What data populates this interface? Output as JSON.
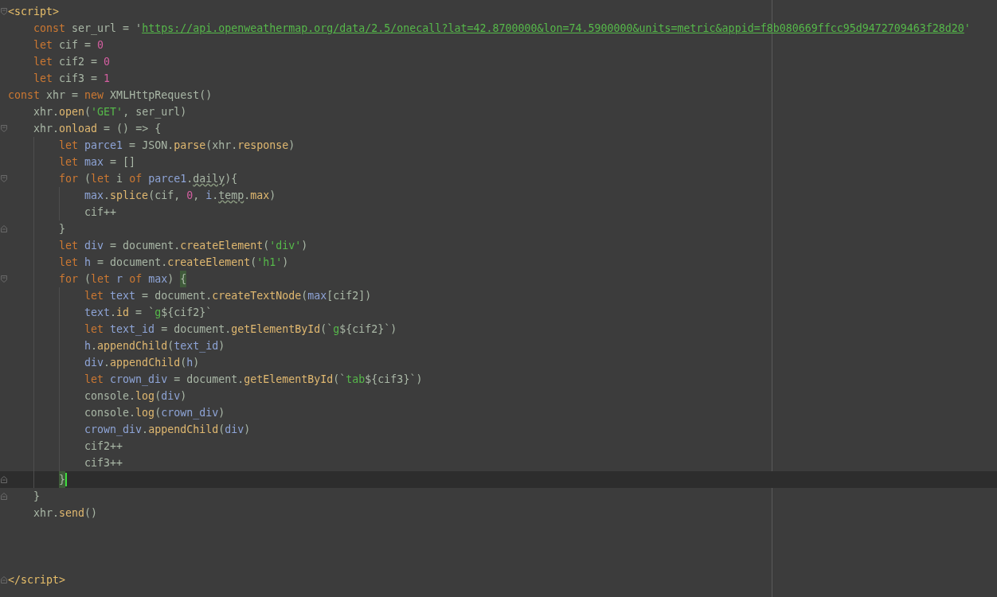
{
  "editor": {
    "lines": [
      {
        "current": false,
        "gutter": {
          "kind": "fold_open"
        },
        "tokens": [
          {
            "text": "<script>",
            "kind": "tag"
          }
        ]
      },
      {
        "current": false,
        "tokens": [
          {
            "text": "    const",
            "kind": "kw"
          },
          {
            "text": " ser_url = '",
            "kind": "plain"
          },
          {
            "text": "https://api.openweathermap.org/data/2.5/onecall?lat=42.8700000&lon=74.5900000&units=metric&appid=f8b080669ffcc95d9472709463f28d20",
            "kind": "link"
          },
          {
            "text": "'",
            "kind": "str"
          }
        ]
      },
      {
        "current": false,
        "tokens": [
          {
            "text": "    let",
            "kind": "kw"
          },
          {
            "text": " cif = ",
            "kind": "plain"
          },
          {
            "text": "0",
            "kind": "num"
          }
        ]
      },
      {
        "current": false,
        "tokens": [
          {
            "text": "    let",
            "kind": "kw"
          },
          {
            "text": " cif2 = ",
            "kind": "plain"
          },
          {
            "text": "0",
            "kind": "num"
          }
        ]
      },
      {
        "current": false,
        "tokens": [
          {
            "text": "    let",
            "kind": "kw"
          },
          {
            "text": " cif3 = ",
            "kind": "plain"
          },
          {
            "text": "1",
            "kind": "num"
          }
        ]
      },
      {
        "current": false,
        "tokens": [
          {
            "text": "const",
            "kind": "kw"
          },
          {
            "text": " xhr = ",
            "kind": "plain"
          },
          {
            "text": "new",
            "kind": "kw"
          },
          {
            "text": " XMLHttpRequest()",
            "kind": "plain"
          }
        ]
      },
      {
        "current": false,
        "tokens": [
          {
            "text": "    xhr.",
            "kind": "plain"
          },
          {
            "text": "open",
            "kind": "fn"
          },
          {
            "text": "(",
            "kind": "plain"
          },
          {
            "text": "'GET'",
            "kind": "str"
          },
          {
            "text": ", ser_url)",
            "kind": "plain"
          }
        ]
      },
      {
        "current": false,
        "gutter": {
          "kind": "fold_open"
        },
        "tokens": [
          {
            "text": "    xhr.",
            "kind": "plain"
          },
          {
            "text": "onload",
            "kind": "fn"
          },
          {
            "text": " = () => {",
            "kind": "plain"
          }
        ]
      },
      {
        "current": false,
        "tokens": [
          {
            "text": "        let",
            "kind": "kw"
          },
          {
            "text": " parce1",
            "kind": "var"
          },
          {
            "text": " = JSON.",
            "kind": "plain"
          },
          {
            "text": "parse",
            "kind": "fn"
          },
          {
            "text": "(xhr.",
            "kind": "plain"
          },
          {
            "text": "response",
            "kind": "fn"
          },
          {
            "text": ")",
            "kind": "plain"
          }
        ]
      },
      {
        "current": false,
        "tokens": [
          {
            "text": "        let",
            "kind": "kw"
          },
          {
            "text": " max",
            "kind": "var"
          },
          {
            "text": " = []",
            "kind": "plain"
          }
        ]
      },
      {
        "current": false,
        "gutter": {
          "kind": "fold_open"
        },
        "tokens": [
          {
            "text": "        for",
            "kind": "kw"
          },
          {
            "text": " (",
            "kind": "plain"
          },
          {
            "text": "let",
            "kind": "kw"
          },
          {
            "text": " i ",
            "kind": "plain"
          },
          {
            "text": "of",
            "kind": "kw"
          },
          {
            "text": " parce1",
            "kind": "var"
          },
          {
            "text": ".",
            "kind": "plain"
          },
          {
            "text": "daily",
            "kind": "warn"
          },
          {
            "text": "){",
            "kind": "plain"
          }
        ]
      },
      {
        "current": false,
        "tokens": [
          {
            "text": "            max",
            "kind": "var"
          },
          {
            "text": ".",
            "kind": "plain"
          },
          {
            "text": "splice",
            "kind": "fn"
          },
          {
            "text": "(cif, ",
            "kind": "plain"
          },
          {
            "text": "0",
            "kind": "num"
          },
          {
            "text": ", ",
            "kind": "plain"
          },
          {
            "text": "i",
            "kind": "var"
          },
          {
            "text": ".",
            "kind": "plain"
          },
          {
            "text": "temp",
            "kind": "warn"
          },
          {
            "text": ".",
            "kind": "plain"
          },
          {
            "text": "max",
            "kind": "fn"
          },
          {
            "text": ")",
            "kind": "plain"
          }
        ]
      },
      {
        "current": false,
        "tokens": [
          {
            "text": "            cif++",
            "kind": "plain"
          }
        ]
      },
      {
        "current": false,
        "gutter": {
          "kind": "fold_close"
        },
        "tokens": [
          {
            "text": "        }",
            "kind": "plain"
          }
        ]
      },
      {
        "current": false,
        "tokens": [
          {
            "text": "        let",
            "kind": "kw"
          },
          {
            "text": " div",
            "kind": "var"
          },
          {
            "text": " = document.",
            "kind": "plain"
          },
          {
            "text": "createElement",
            "kind": "fn"
          },
          {
            "text": "(",
            "kind": "plain"
          },
          {
            "text": "'div'",
            "kind": "str"
          },
          {
            "text": ")",
            "kind": "plain"
          }
        ]
      },
      {
        "current": false,
        "tokens": [
          {
            "text": "        let",
            "kind": "kw"
          },
          {
            "text": " h",
            "kind": "var"
          },
          {
            "text": " = document.",
            "kind": "plain"
          },
          {
            "text": "createElement",
            "kind": "fn"
          },
          {
            "text": "(",
            "kind": "plain"
          },
          {
            "text": "'h1'",
            "kind": "str"
          },
          {
            "text": ")",
            "kind": "plain"
          }
        ]
      },
      {
        "current": false,
        "gutter": {
          "kind": "fold_open"
        },
        "tokens": [
          {
            "text": "        for",
            "kind": "kw"
          },
          {
            "text": " (",
            "kind": "plain"
          },
          {
            "text": "let",
            "kind": "kw"
          },
          {
            "text": " r",
            "kind": "var"
          },
          {
            "text": " of",
            "kind": "kw"
          },
          {
            "text": " max",
            "kind": "var"
          },
          {
            "text": ") ",
            "kind": "plain"
          },
          {
            "text": "{",
            "kind": "match"
          }
        ]
      },
      {
        "current": false,
        "tokens": [
          {
            "text": "            let",
            "kind": "kw"
          },
          {
            "text": " text",
            "kind": "var"
          },
          {
            "text": " = document.",
            "kind": "plain"
          },
          {
            "text": "createTextNode",
            "kind": "fn"
          },
          {
            "text": "(",
            "kind": "plain"
          },
          {
            "text": "max",
            "kind": "var"
          },
          {
            "text": "[cif2])",
            "kind": "plain"
          }
        ]
      },
      {
        "current": false,
        "tokens": [
          {
            "text": "            text",
            "kind": "var"
          },
          {
            "text": ".",
            "kind": "plain"
          },
          {
            "text": "id",
            "kind": "fn"
          },
          {
            "text": " = `",
            "kind": "plain"
          },
          {
            "text": "g",
            "kind": "str"
          },
          {
            "text": "${cif2}`",
            "kind": "plain"
          }
        ]
      },
      {
        "current": false,
        "tokens": [
          {
            "text": "            let",
            "kind": "kw"
          },
          {
            "text": " text_id",
            "kind": "var"
          },
          {
            "text": " = document.",
            "kind": "plain"
          },
          {
            "text": "getElementById",
            "kind": "fn"
          },
          {
            "text": "(`",
            "kind": "plain"
          },
          {
            "text": "g",
            "kind": "str"
          },
          {
            "text": "${cif2}`)",
            "kind": "plain"
          }
        ]
      },
      {
        "current": false,
        "tokens": [
          {
            "text": "            h",
            "kind": "var"
          },
          {
            "text": ".",
            "kind": "plain"
          },
          {
            "text": "appendChild",
            "kind": "fn"
          },
          {
            "text": "(",
            "kind": "plain"
          },
          {
            "text": "text_id",
            "kind": "var"
          },
          {
            "text": ")",
            "kind": "plain"
          }
        ]
      },
      {
        "current": false,
        "tokens": [
          {
            "text": "            div",
            "kind": "var"
          },
          {
            "text": ".",
            "kind": "plain"
          },
          {
            "text": "appendChild",
            "kind": "fn"
          },
          {
            "text": "(",
            "kind": "plain"
          },
          {
            "text": "h",
            "kind": "var"
          },
          {
            "text": ")",
            "kind": "plain"
          }
        ]
      },
      {
        "current": false,
        "tokens": [
          {
            "text": "            let",
            "kind": "kw"
          },
          {
            "text": " crown_div",
            "kind": "var"
          },
          {
            "text": " = document.",
            "kind": "plain"
          },
          {
            "text": "getElementById",
            "kind": "fn"
          },
          {
            "text": "(`",
            "kind": "plain"
          },
          {
            "text": "tab",
            "kind": "str"
          },
          {
            "text": "${cif3}`)",
            "kind": "plain"
          }
        ]
      },
      {
        "current": false,
        "tokens": [
          {
            "text": "            console.",
            "kind": "plain"
          },
          {
            "text": "log",
            "kind": "fn"
          },
          {
            "text": "(",
            "kind": "plain"
          },
          {
            "text": "div",
            "kind": "var"
          },
          {
            "text": ")",
            "kind": "plain"
          }
        ]
      },
      {
        "current": false,
        "tokens": [
          {
            "text": "            console.",
            "kind": "plain"
          },
          {
            "text": "log",
            "kind": "fn"
          },
          {
            "text": "(",
            "kind": "plain"
          },
          {
            "text": "crown_div",
            "kind": "var"
          },
          {
            "text": ")",
            "kind": "plain"
          }
        ]
      },
      {
        "current": false,
        "tokens": [
          {
            "text": "            crown_div",
            "kind": "var"
          },
          {
            "text": ".",
            "kind": "plain"
          },
          {
            "text": "appendChild",
            "kind": "fn"
          },
          {
            "text": "(",
            "kind": "plain"
          },
          {
            "text": "div",
            "kind": "var"
          },
          {
            "text": ")",
            "kind": "plain"
          }
        ]
      },
      {
        "current": false,
        "tokens": [
          {
            "text": "            cif2++",
            "kind": "plain"
          }
        ]
      },
      {
        "current": false,
        "tokens": [
          {
            "text": "            cif3++",
            "kind": "plain"
          }
        ]
      },
      {
        "current": true,
        "gutter": {
          "kind": "fold_close"
        },
        "tokens": [
          {
            "text": "        }",
            "kind": "match"
          }
        ]
      },
      {
        "current": false,
        "gutter": {
          "kind": "fold_close"
        },
        "tokens": [
          {
            "text": "    }",
            "kind": "plain"
          }
        ]
      },
      {
        "current": false,
        "tokens": [
          {
            "text": "    xhr.",
            "kind": "plain"
          },
          {
            "text": "send",
            "kind": "fn"
          },
          {
            "text": "()",
            "kind": "plain"
          }
        ]
      },
      {
        "current": false
      },
      {
        "current": false
      },
      {
        "current": false
      },
      {
        "current": false,
        "gutter": {
          "kind": "fold_close"
        },
        "tokens": [
          {
            "text": "</script>",
            "kind": "tag"
          }
        ]
      }
    ]
  }
}
